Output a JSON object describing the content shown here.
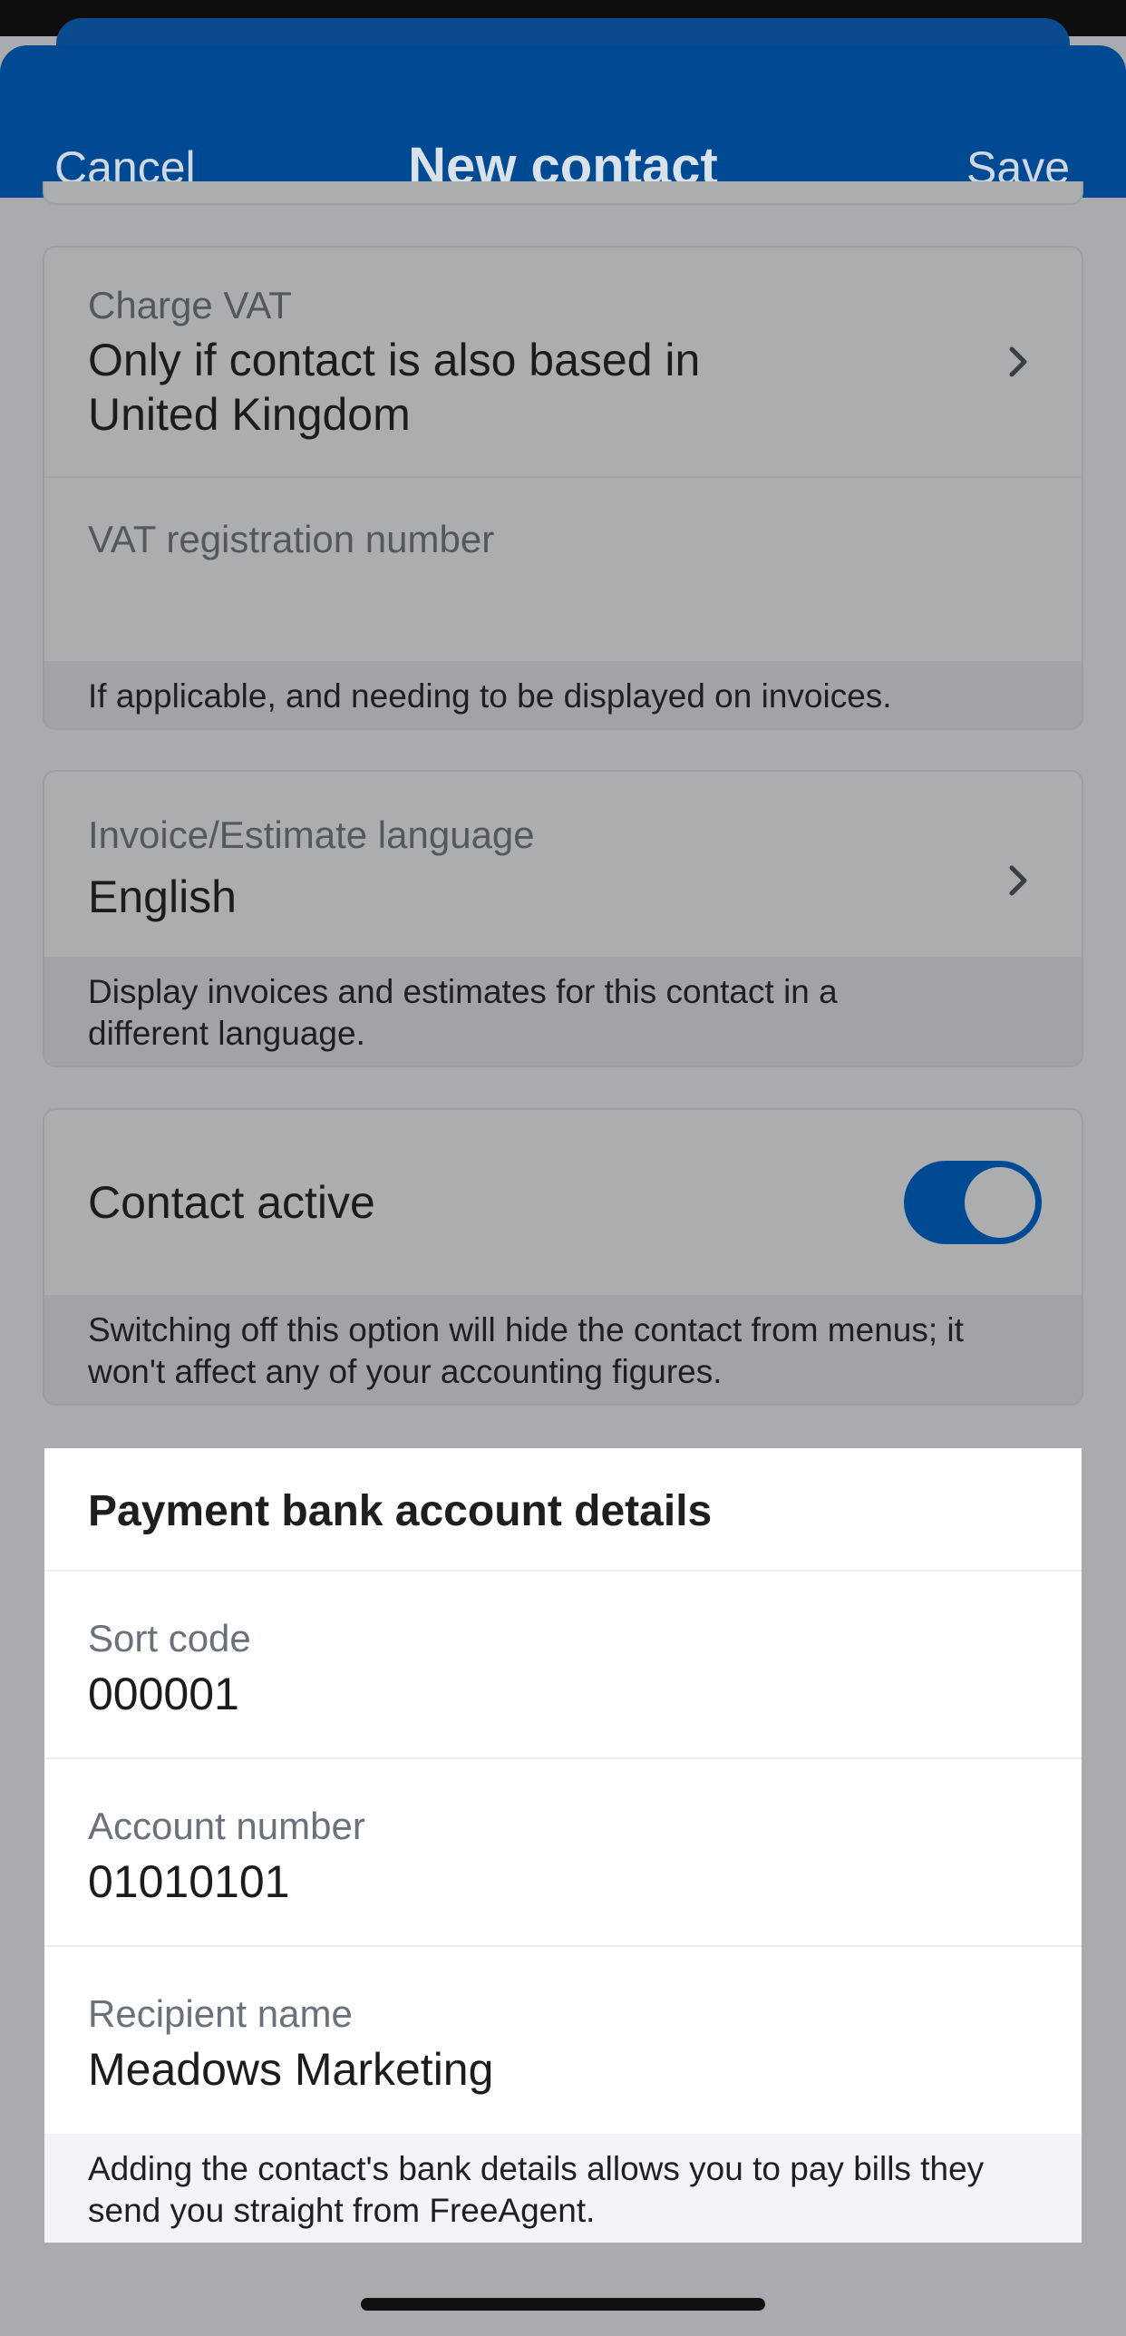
{
  "header": {
    "cancel_label": "Cancel",
    "title": "New contact",
    "save_label": "Save"
  },
  "vat_card": {
    "charge_vat_label": "Charge VAT",
    "charge_vat_value_line1": "Only if contact is also based in",
    "charge_vat_value_line2": "United Kingdom",
    "vat_number_label": "VAT registration number",
    "vat_number_value": "",
    "footer": "If applicable, and needing to be displayed on invoices."
  },
  "language_card": {
    "label": "Invoice/Estimate language",
    "value": "English",
    "footer_line1": "Display invoices and estimates for this contact in a",
    "footer_line2": "different language."
  },
  "active_card": {
    "label": "Contact active",
    "toggle_on": true,
    "footer_line1": "Switching off this option will hide the contact from menus; it",
    "footer_line2": "won't affect any of your accounting figures."
  },
  "bank_card": {
    "title": "Payment bank account details",
    "sort_code_label": "Sort code",
    "sort_code_value": "000001",
    "account_number_label": "Account number",
    "account_number_value": "01010101",
    "recipient_label": "Recipient name",
    "recipient_value": "Meadows Marketing",
    "footer_line1": "Adding the contact's bank details allows you to pay bills they",
    "footer_line2": "send you straight from FreeAgent."
  },
  "colors": {
    "brand": "#004a93",
    "overlay": "#a9abae"
  },
  "icons": {
    "chevron": "chevron-right-icon"
  }
}
